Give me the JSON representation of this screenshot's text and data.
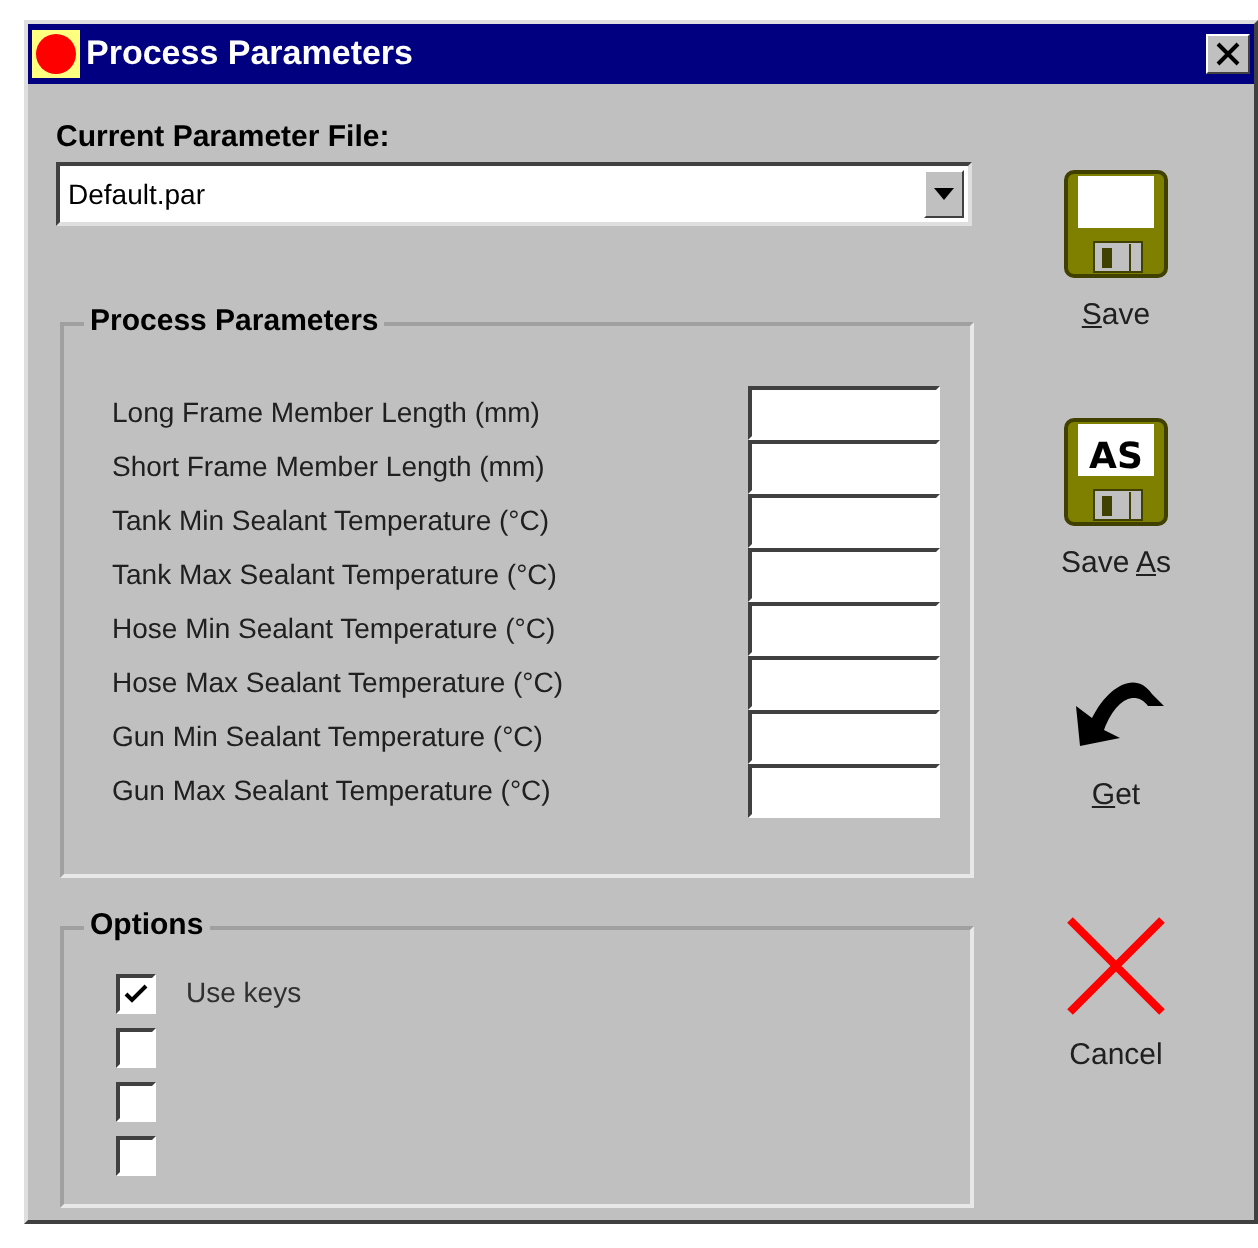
{
  "window": {
    "title": "Process Parameters"
  },
  "parameter_file": {
    "label": "Current Parameter File:",
    "value": "Default.par"
  },
  "process_parameters": {
    "title": "Process Parameters",
    "rows": [
      {
        "label": "Long Frame Member Length (mm)"
      },
      {
        "label": "Short Frame Member Length (mm)"
      },
      {
        "label": "Tank Min Sealant Temperature (°C)"
      },
      {
        "label": "Tank Max Sealant Temperature (°C)"
      },
      {
        "label": "Hose Min Sealant Temperature (°C)"
      },
      {
        "label": "Hose Max Sealant Temperature (°C)"
      },
      {
        "label": "Gun Min Sealant Temperature (°C)"
      },
      {
        "label": "Gun Max Sealant Temperature (°C)"
      }
    ]
  },
  "options": {
    "title": "Options",
    "items": [
      {
        "label": "Use keys",
        "checked": true
      },
      {
        "checked": false
      },
      {
        "checked": false
      },
      {
        "checked": false
      }
    ]
  },
  "buttons": [
    {
      "kind": "save",
      "label": [
        {
          "text": "S",
          "underlined": true
        },
        {
          "text": "ave",
          "underlined": false
        }
      ]
    },
    {
      "kind": "save_as",
      "label": [
        {
          "text": "Save ",
          "underlined": false
        },
        {
          "text": "A",
          "underlined": true
        },
        {
          "text": "s",
          "underlined": false
        }
      ],
      "icon_text": "AS"
    },
    {
      "kind": "get",
      "label": [
        {
          "text": "G",
          "underlined": true
        },
        {
          "text": "et",
          "underlined": false
        }
      ]
    },
    {
      "kind": "cancel",
      "label": [
        {
          "text": "Cancel",
          "underlined": false
        }
      ]
    }
  ]
}
